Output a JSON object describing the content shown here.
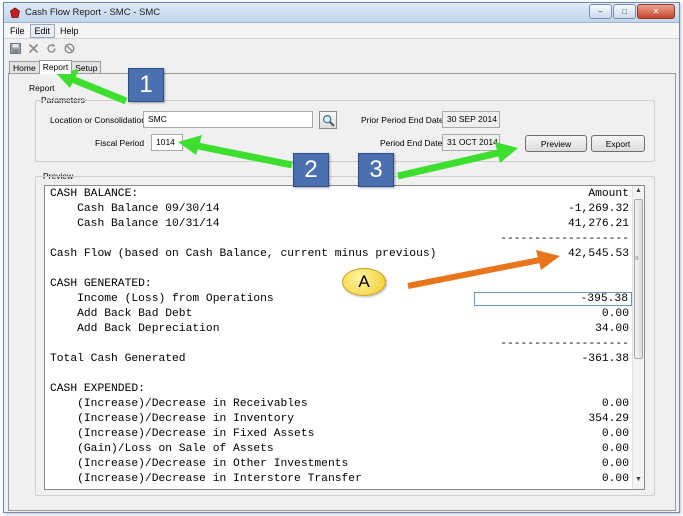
{
  "window": {
    "title": "Cash Flow Report - SMC - SMC",
    "icon": "red-app-icon",
    "controls": [
      "minimize-icon",
      "maximize-icon",
      "close-icon"
    ]
  },
  "menu": [
    "File",
    "Edit",
    "Help"
  ],
  "toolbar": [
    "save-icon",
    "delete-icon",
    "refresh-icon",
    "cancel-icon"
  ],
  "tabs": {
    "items": [
      "Home",
      "Report",
      "Setup"
    ],
    "active": "Report"
  },
  "report_label": "Report",
  "parameters": {
    "legend": "Parameters",
    "location_label": "Location or Consolidation",
    "location_value": "SMC",
    "fiscal_period_label": "Fiscal Period",
    "fiscal_period_value": "1014",
    "prior_period_label": "Prior Period End Date",
    "prior_period_value": "30 SEP 2014",
    "period_end_label": "Period End Date",
    "period_end_value": "31 OCT 2014",
    "preview_button": "Preview",
    "export_button": "Export"
  },
  "preview": {
    "legend": "Preview",
    "lines": [
      {
        "text": "CASH BALANCE:",
        "value": "Amount"
      },
      {
        "text": "    Cash Balance 09/30/14",
        "value": "-1,269.32"
      },
      {
        "text": "    Cash Balance 10/31/14",
        "value": "41,276.21"
      },
      {
        "text": "",
        "value": "-------------------"
      },
      {
        "text": "Cash Flow (based on Cash Balance, current minus previous)",
        "value": "42,545.53"
      },
      {
        "text": "",
        "value": ""
      },
      {
        "text": "CASH GENERATED:",
        "value": ""
      },
      {
        "text": "    Income (Loss) from Operations",
        "value": "-395.38",
        "selected": true
      },
      {
        "text": "    Add Back Bad Debt",
        "value": "0.00"
      },
      {
        "text": "    Add Back Depreciation",
        "value": "34.00"
      },
      {
        "text": "",
        "value": "-------------------"
      },
      {
        "text": "Total Cash Generated",
        "value": "-361.38"
      },
      {
        "text": "",
        "value": ""
      },
      {
        "text": "CASH EXPENDED:",
        "value": ""
      },
      {
        "text": "    (Increase)/Decrease in Receivables",
        "value": "0.00"
      },
      {
        "text": "    (Increase)/Decrease in Inventory",
        "value": "354.29"
      },
      {
        "text": "    (Increase)/Decrease in Fixed Assets",
        "value": "0.00"
      },
      {
        "text": "    (Gain)/Loss on Sale of Assets",
        "value": "0.00"
      },
      {
        "text": "    (Increase)/Decrease in Other Investments",
        "value": "0.00"
      },
      {
        "text": "    (Increase)/Decrease in Interstore Transfer",
        "value": "0.00"
      }
    ]
  },
  "annotations": {
    "callouts": [
      "1",
      "2",
      "3",
      "A"
    ],
    "arrow_color_green": "#3ddf2e",
    "arrow_color_orange": "#e8741c"
  }
}
